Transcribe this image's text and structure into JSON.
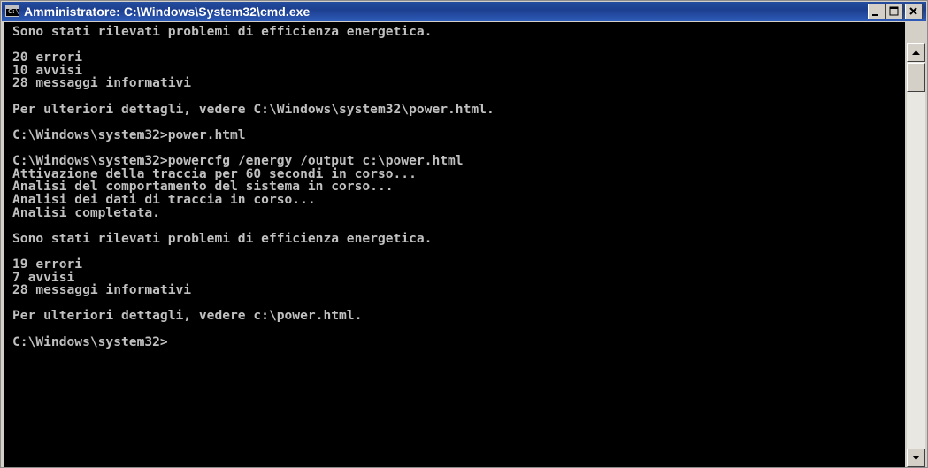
{
  "window": {
    "title": "Amministratore: C:\\Windows\\System32\\cmd.exe",
    "icon": "console-icon",
    "icon_text": "C:\\"
  },
  "controls": {
    "minimize_icon": "minimize-icon",
    "maximize_icon": "maximize-icon",
    "close_icon": "close-icon"
  },
  "console": {
    "foreground": "#c0c0c0",
    "background": "#000000",
    "lines": [
      "Sono stati rilevati problemi di efficienza energetica.",
      "",
      "20 errori",
      "10 avvisi",
      "28 messaggi informativi",
      "",
      "Per ulteriori dettagli, vedere C:\\Windows\\system32\\power.html.",
      "",
      "C:\\Windows\\system32>power.html",
      "",
      "C:\\Windows\\system32>powercfg /energy /output c:\\power.html",
      "Attivazione della traccia per 60 secondi in corso...",
      "Analisi del comportamento del sistema in corso...",
      "Analisi dei dati di traccia in corso...",
      "Analisi completata.",
      "",
      "Sono stati rilevati problemi di efficienza energetica.",
      "",
      "19 errori",
      "7 avvisi",
      "28 messaggi informativi",
      "",
      "Per ulteriori dettagli, vedere c:\\power.html.",
      "",
      "C:\\Windows\\system32>"
    ]
  },
  "scrollbar": {
    "up_icon": "arrow-up-icon",
    "down_icon": "arrow-down-icon"
  }
}
